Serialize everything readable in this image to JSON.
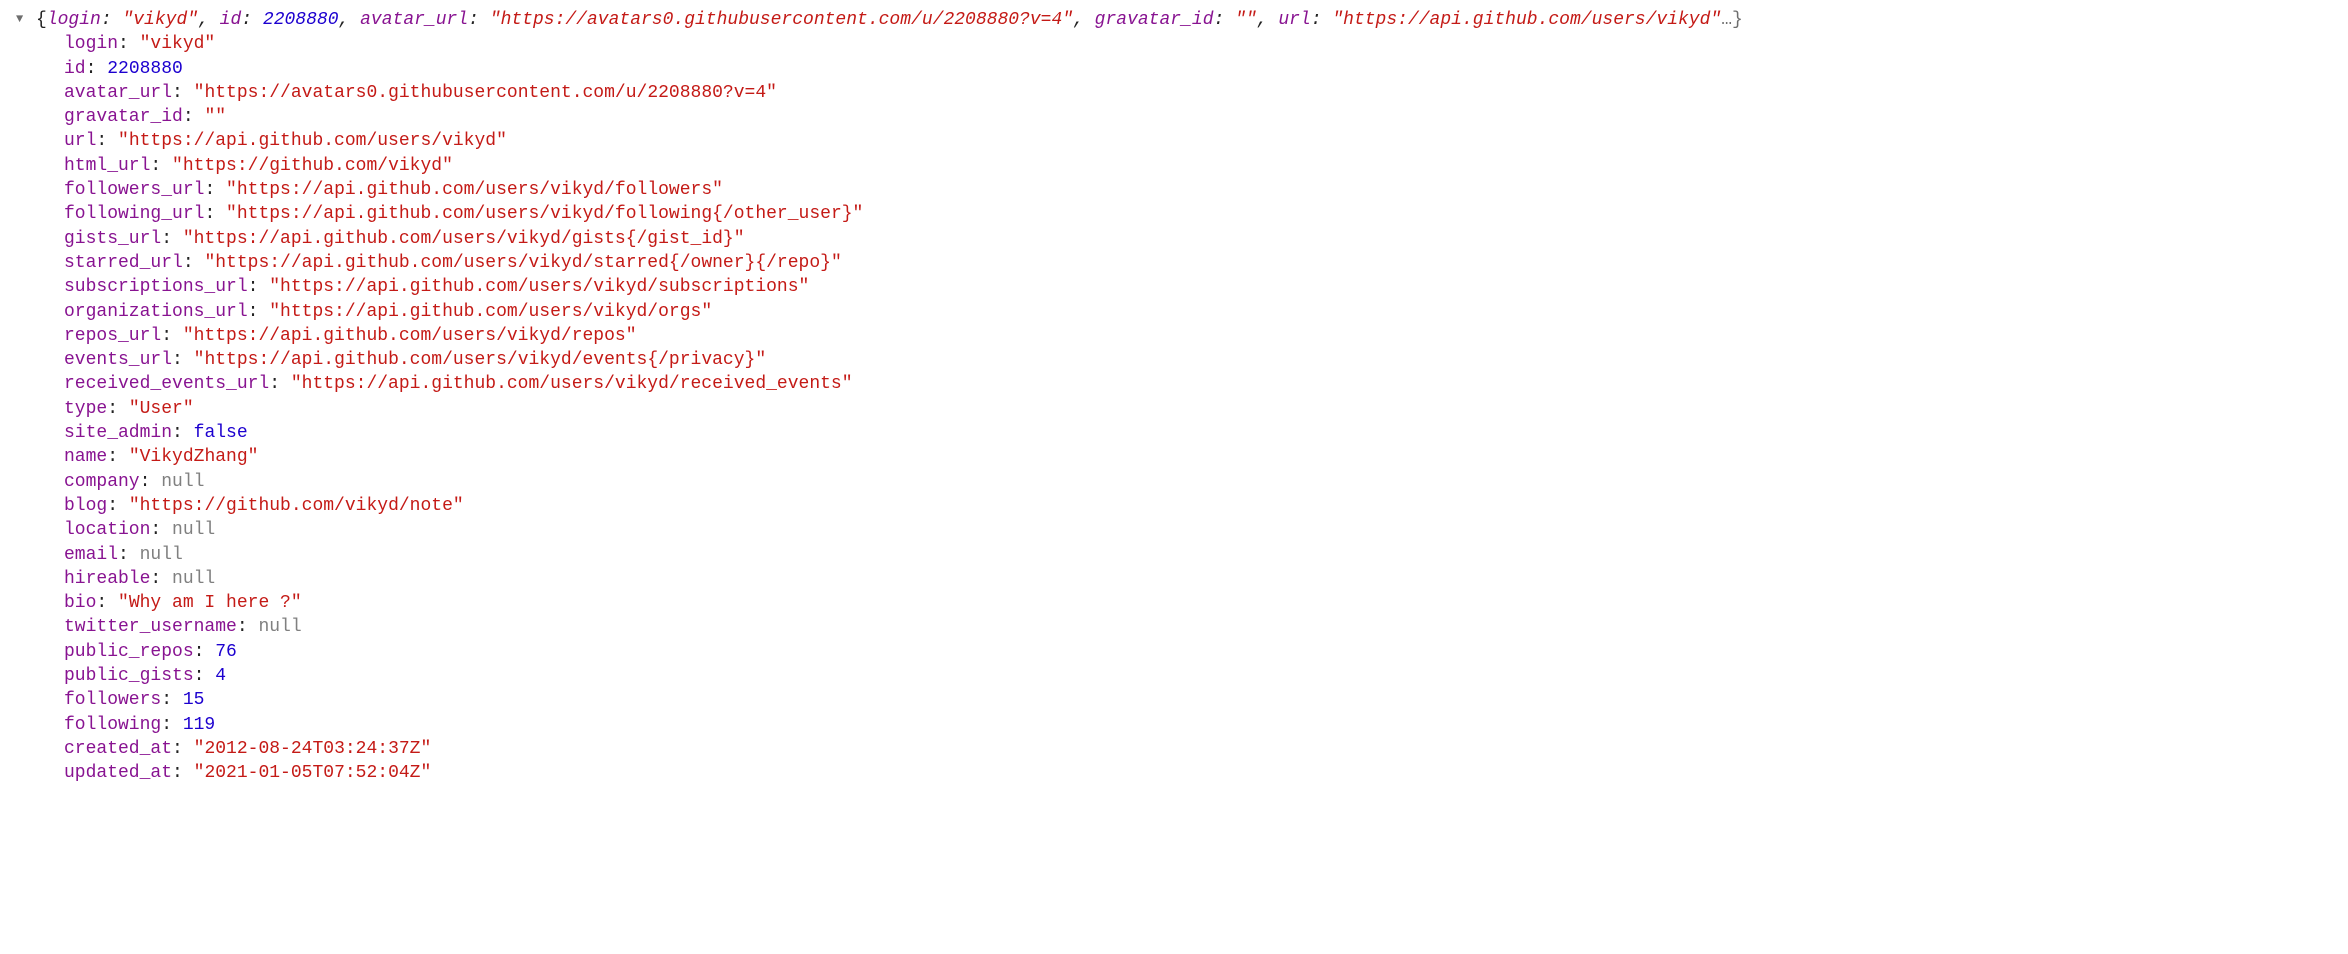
{
  "summary": {
    "preview_pairs": [
      {
        "key": "login",
        "type": "str",
        "value": "\"vikyd\""
      },
      {
        "key": "id",
        "type": "num",
        "value": "2208880"
      },
      {
        "key": "avatar_url",
        "type": "str",
        "value": "\"https://avatars0.githubusercontent.com/u/2208880?v=4\""
      },
      {
        "key": "gravatar_id",
        "type": "str",
        "value": "\"\""
      },
      {
        "key": "url",
        "type": "str",
        "value": "\"https://api.github.com/users/vikyd\""
      }
    ],
    "truncated_tail": "…}"
  },
  "properties": [
    {
      "key": "login",
      "type": "str",
      "value": "\"vikyd\""
    },
    {
      "key": "id",
      "type": "num",
      "value": "2208880"
    },
    {
      "key": "avatar_url",
      "type": "str",
      "value": "\"https://avatars0.githubusercontent.com/u/2208880?v=4\""
    },
    {
      "key": "gravatar_id",
      "type": "str",
      "value": "\"\""
    },
    {
      "key": "url",
      "type": "str",
      "value": "\"https://api.github.com/users/vikyd\""
    },
    {
      "key": "html_url",
      "type": "str",
      "value": "\"https://github.com/vikyd\""
    },
    {
      "key": "followers_url",
      "type": "str",
      "value": "\"https://api.github.com/users/vikyd/followers\""
    },
    {
      "key": "following_url",
      "type": "str",
      "value": "\"https://api.github.com/users/vikyd/following{/other_user}\""
    },
    {
      "key": "gists_url",
      "type": "str",
      "value": "\"https://api.github.com/users/vikyd/gists{/gist_id}\""
    },
    {
      "key": "starred_url",
      "type": "str",
      "value": "\"https://api.github.com/users/vikyd/starred{/owner}{/repo}\""
    },
    {
      "key": "subscriptions_url",
      "type": "str",
      "value": "\"https://api.github.com/users/vikyd/subscriptions\""
    },
    {
      "key": "organizations_url",
      "type": "str",
      "value": "\"https://api.github.com/users/vikyd/orgs\""
    },
    {
      "key": "repos_url",
      "type": "str",
      "value": "\"https://api.github.com/users/vikyd/repos\""
    },
    {
      "key": "events_url",
      "type": "str",
      "value": "\"https://api.github.com/users/vikyd/events{/privacy}\""
    },
    {
      "key": "received_events_url",
      "type": "str",
      "value": "\"https://api.github.com/users/vikyd/received_events\""
    },
    {
      "key": "type",
      "type": "str",
      "value": "\"User\""
    },
    {
      "key": "site_admin",
      "type": "bool",
      "value": "false"
    },
    {
      "key": "name",
      "type": "str",
      "value": "\"VikydZhang\""
    },
    {
      "key": "company",
      "type": "null",
      "value": "null"
    },
    {
      "key": "blog",
      "type": "str",
      "value": "\"https://github.com/vikyd/note\""
    },
    {
      "key": "location",
      "type": "null",
      "value": "null"
    },
    {
      "key": "email",
      "type": "null",
      "value": "null"
    },
    {
      "key": "hireable",
      "type": "null",
      "value": "null"
    },
    {
      "key": "bio",
      "type": "str",
      "value": "\"Why am I here ?\""
    },
    {
      "key": "twitter_username",
      "type": "null",
      "value": "null"
    },
    {
      "key": "public_repos",
      "type": "num",
      "value": "76"
    },
    {
      "key": "public_gists",
      "type": "num",
      "value": "4"
    },
    {
      "key": "followers",
      "type": "num",
      "value": "15"
    },
    {
      "key": "following",
      "type": "num",
      "value": "119"
    },
    {
      "key": "created_at",
      "type": "str",
      "value": "\"2012-08-24T03:24:37Z\""
    },
    {
      "key": "updated_at",
      "type": "str",
      "value": "\"2021-01-05T07:52:04Z\""
    }
  ]
}
